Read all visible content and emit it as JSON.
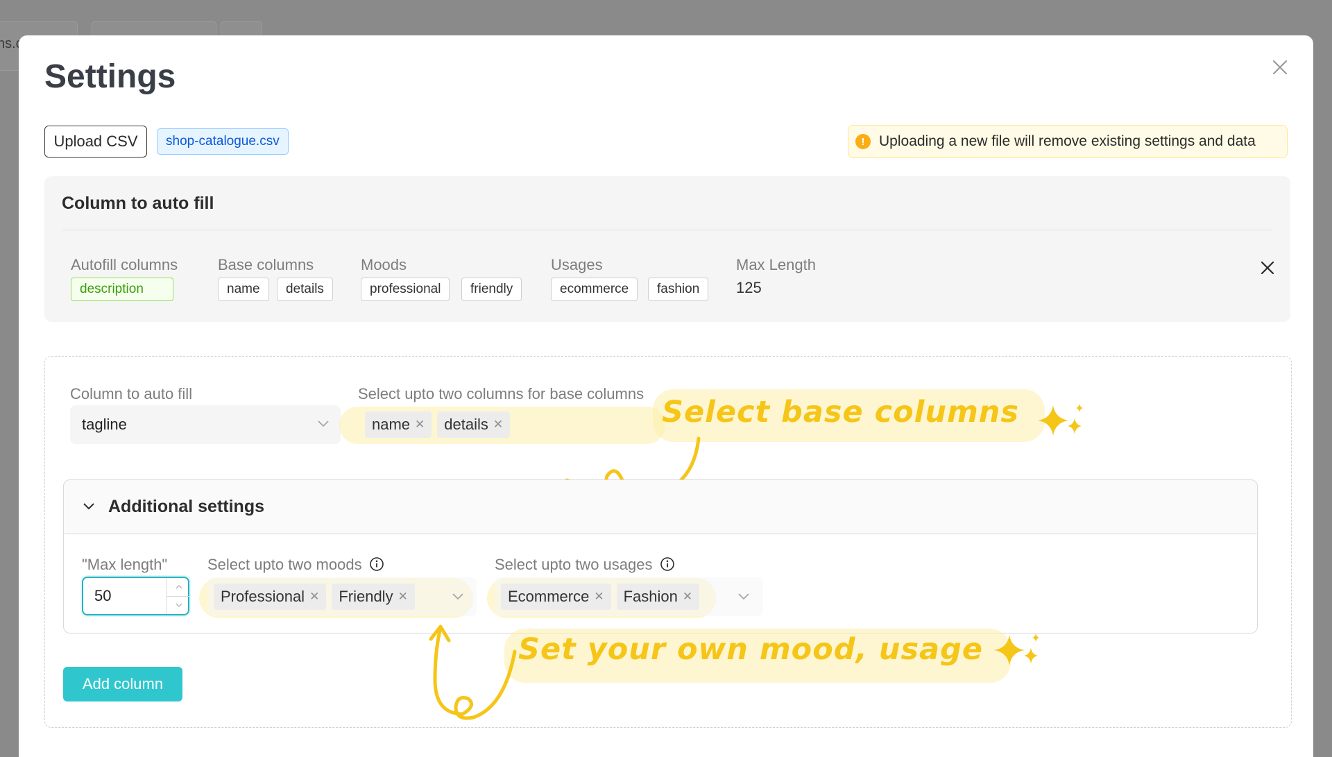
{
  "background": {
    "partial_text": "ns.c"
  },
  "modal": {
    "title": "Settings",
    "close_icon": "close-icon"
  },
  "upload": {
    "button_label": "Upload CSV",
    "file_name": "shop-catalogue.csv"
  },
  "warning": {
    "icon_glyph": "!",
    "text": "Uploading a new file will remove existing settings and data"
  },
  "summary": {
    "title": "Column to auto fill",
    "headers": {
      "autofill": "Autofill columns",
      "base": "Base columns",
      "moods": "Moods",
      "usages": "Usages",
      "max_length": "Max Length"
    },
    "autofill_columns": [
      "description"
    ],
    "base_columns": [
      "name",
      "details"
    ],
    "moods": [
      "professional",
      "friendly"
    ],
    "usages": [
      "ecommerce",
      "fashion"
    ],
    "max_length": "125"
  },
  "form": {
    "column_label": "Column to auto fill",
    "column_value": "tagline",
    "base_label": "Select upto two columns for base columns",
    "base_selected": [
      "name",
      "details"
    ],
    "additional": {
      "title": "Additional settings",
      "max_length_label": "\"Max length\"",
      "max_length_value": "50",
      "moods_label": "Select upto two moods",
      "moods_selected": [
        "Professional",
        "Friendly"
      ],
      "usages_label": "Select upto two usages",
      "usages_selected": [
        "Ecommerce",
        "Fashion"
      ]
    },
    "add_button": "Add column"
  },
  "callouts": {
    "base": "Select base columns",
    "mood": "Set your own mood, usage"
  },
  "colors": {
    "accent": "#2fc7cd",
    "callout": "#f5c518",
    "warning": "#faad14",
    "file_tag": "#0958d9",
    "autofill_tag": "#389e0d"
  }
}
